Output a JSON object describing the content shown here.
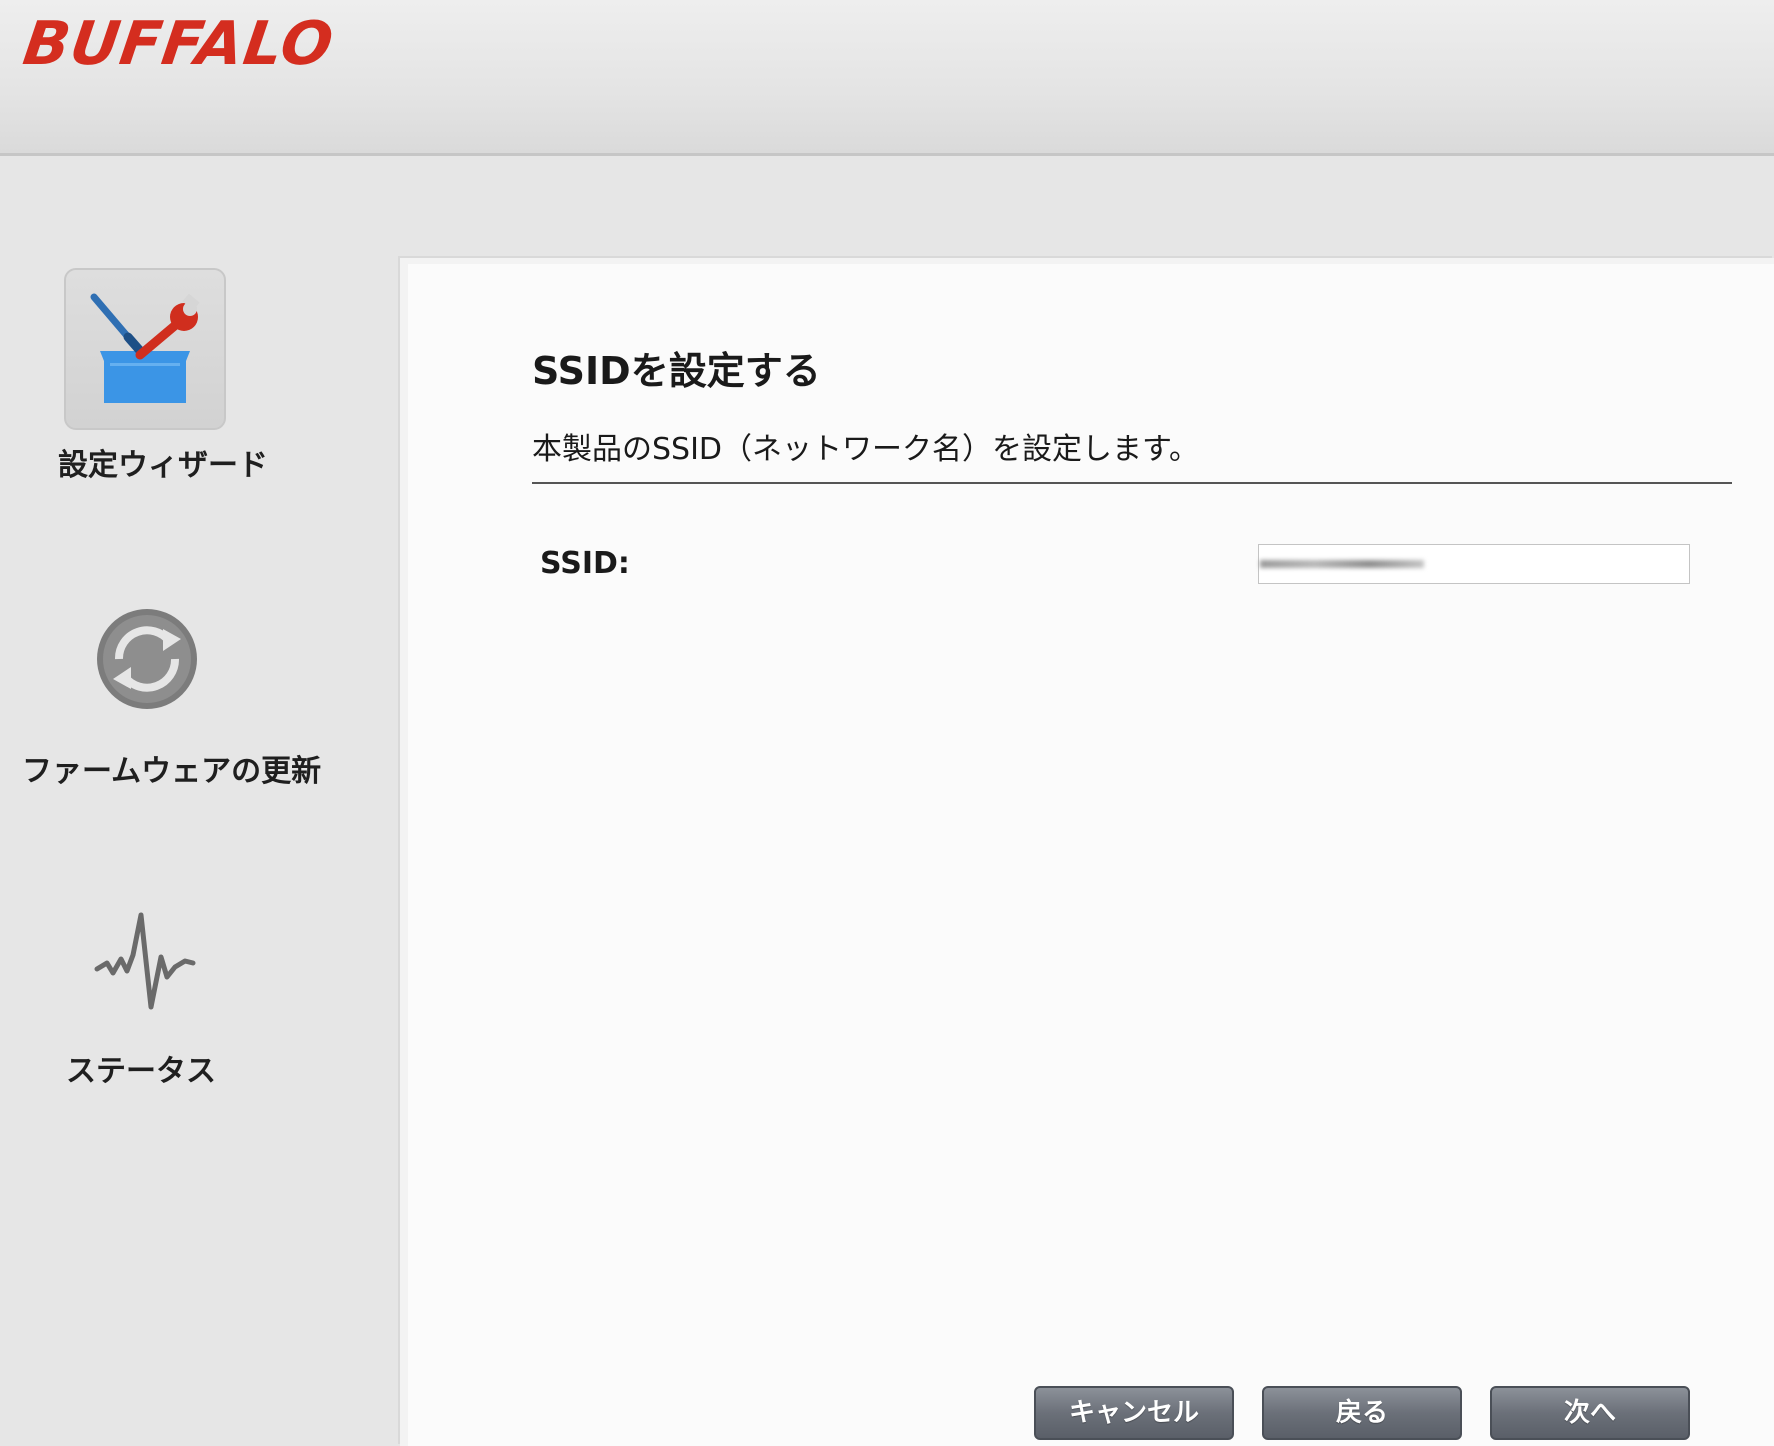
{
  "header": {
    "logo_text": "BUFFALO"
  },
  "sidebar": {
    "items": [
      {
        "label": "設定ウィザード",
        "icon": "toolbox-icon"
      },
      {
        "label": "ファームウェアの更新",
        "icon": "refresh-icon"
      },
      {
        "label": "ステータス",
        "icon": "pulse-icon"
      }
    ]
  },
  "main": {
    "title": "SSIDを設定する",
    "description": "本製品のSSID（ネットワーク名）を設定します。",
    "ssid_label": "SSID:"
  },
  "buttons": {
    "cancel": "キャンセル",
    "back": "戻る",
    "next": "次へ"
  },
  "colors": {
    "brand": "#d42d1f",
    "toolbox_blue": "#3b95e6",
    "button_gray": "#6b7079"
  }
}
